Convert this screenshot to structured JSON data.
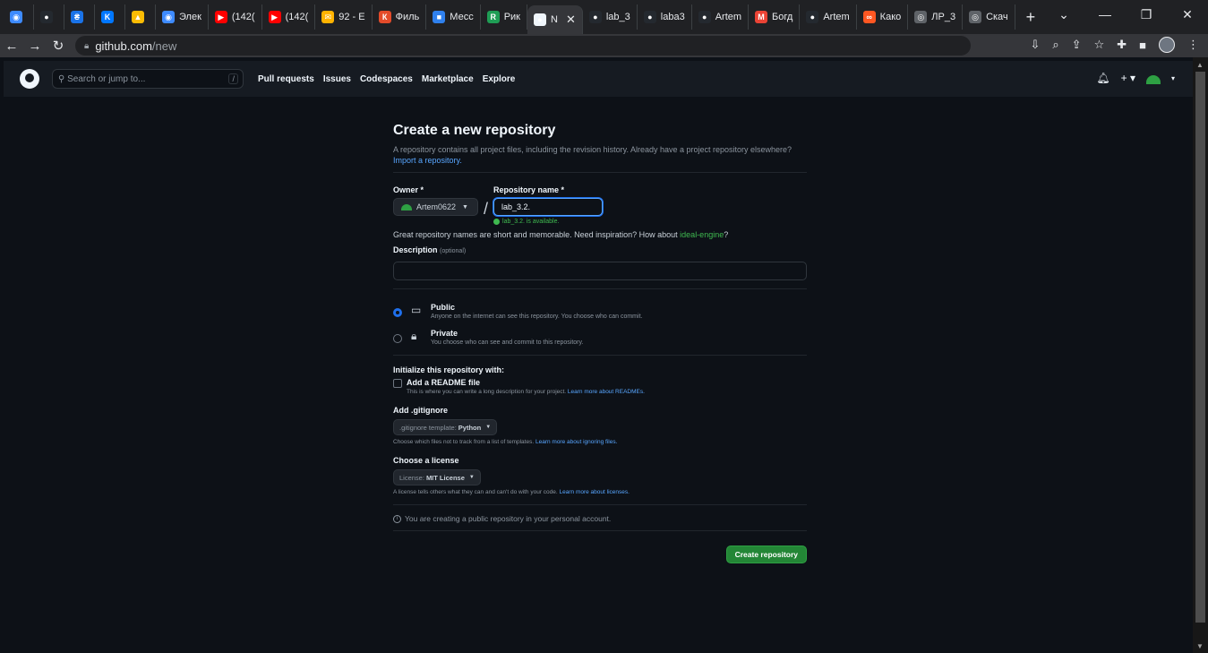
{
  "browser": {
    "tabs": [
      {
        "label": "",
        "color": "#3e8bff",
        "glyph": "◉"
      },
      {
        "label": "",
        "color": "#24292f",
        "glyph": "●"
      },
      {
        "label": "",
        "color": "#1a73e8",
        "glyph": "₴"
      },
      {
        "label": "",
        "color": "#0077ff",
        "glyph": "K"
      },
      {
        "label": "",
        "color": "#fbbc04",
        "glyph": "▲"
      },
      {
        "label": "Элек",
        "color": "#3e8bff",
        "glyph": "◉"
      },
      {
        "label": "(142(",
        "color": "#ff0000",
        "glyph": "▶"
      },
      {
        "label": "(142(",
        "color": "#ff0000",
        "glyph": "▶"
      },
      {
        "label": "92 - E",
        "color": "#ffb300",
        "glyph": "✉"
      },
      {
        "label": "Филь",
        "color": "#e34b2a",
        "glyph": "К"
      },
      {
        "label": "Месс",
        "color": "#2f80ed",
        "glyph": "■"
      },
      {
        "label": "Рик",
        "color": "#1f9d55",
        "glyph": "R"
      },
      {
        "label": "N",
        "color": "#f0f6fc",
        "glyph": "●",
        "active": true
      },
      {
        "label": "lab_3",
        "color": "#24292f",
        "glyph": "●"
      },
      {
        "label": "laba3",
        "color": "#24292f",
        "glyph": "●"
      },
      {
        "label": "Artem",
        "color": "#24292f",
        "glyph": "●"
      },
      {
        "label": "Богд",
        "color": "#ea4335",
        "glyph": "M"
      },
      {
        "label": "Artem",
        "color": "#24292f",
        "glyph": "●"
      },
      {
        "label": "Како",
        "color": "#ff5722",
        "glyph": "∞"
      },
      {
        "label": "ЛР_3",
        "color": "#5f6368",
        "glyph": "◎"
      },
      {
        "label": "Скач",
        "color": "#5f6368",
        "glyph": "◎"
      }
    ],
    "new_tab": "+",
    "url_host": "github.com",
    "url_path": "/new"
  },
  "header": {
    "search_placeholder": "Search or jump to...",
    "search_key": "/",
    "nav": [
      "Pull requests",
      "Issues",
      "Codespaces",
      "Marketplace",
      "Explore"
    ]
  },
  "page": {
    "title": "Create a new repository",
    "subtitle": "A repository contains all project files, including the revision history. Already have a project repository elsewhere?",
    "import_link": "Import a repository.",
    "owner_label": "Owner *",
    "owner_value": "Artem0622",
    "repo_label": "Repository name *",
    "repo_value": "lab_3.2.",
    "available": "lab_3.2. is available.",
    "great_prefix": "Great repository names are short and memorable. Need inspiration? How about ",
    "great_suggestion": "ideal-engine",
    "great_suffix": "?",
    "description_label": "Description",
    "description_optional": "(optional)",
    "public_title": "Public",
    "public_desc": "Anyone on the internet can see this repository. You choose who can commit.",
    "private_title": "Private",
    "private_desc": "You choose who can see and commit to this repository.",
    "init_title": "Initialize this repository with:",
    "readme_title": "Add a README file",
    "readme_desc": "This is where you can write a long description for your project. ",
    "readme_link": "Learn more about READMEs.",
    "gitignore_title": "Add .gitignore",
    "gitignore_prefix": ".gitignore template:",
    "gitignore_value": "Python",
    "gitignore_hint": "Choose which files not to track from a list of templates. ",
    "gitignore_link": "Learn more about ignoring files.",
    "license_title": "Choose a license",
    "license_prefix": "License:",
    "license_value": "MIT License",
    "license_hint": "A license tells others what they can and can't do with your code. ",
    "license_link": "Learn more about licenses.",
    "notice": "You are creating a public repository in your personal account.",
    "create_button": "Create repository"
  }
}
